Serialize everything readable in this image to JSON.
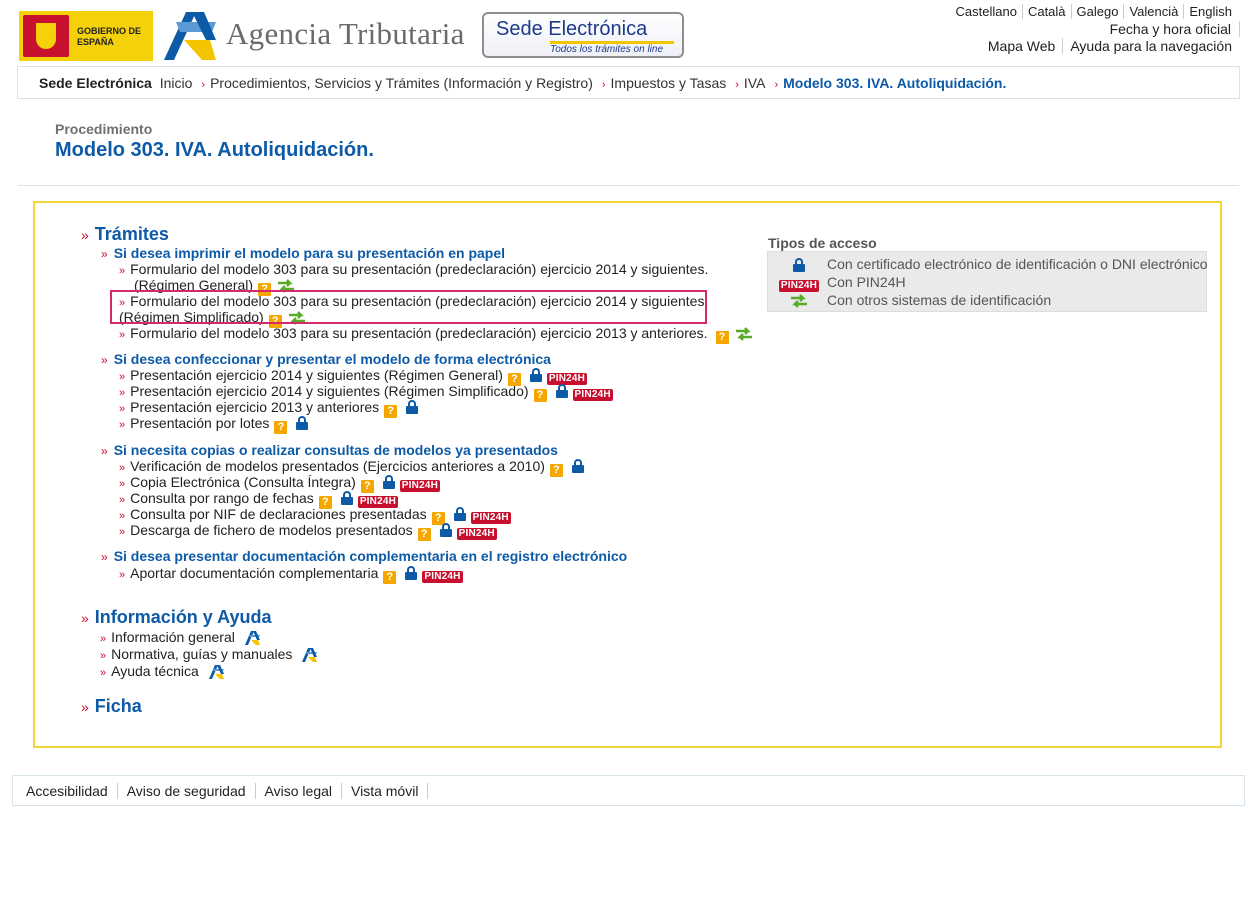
{
  "header": {
    "gobierno_text": "GOBIERNO DE ESPAÑA",
    "agencia": "Agencia Tributaria",
    "sede_title": "Sede Electrónica",
    "sede_sub": "Todos los trámites on line",
    "languages": [
      "Castellano",
      "Català",
      "Galego",
      "Valencià",
      "English"
    ],
    "fecha_hora": "Fecha y hora oficial",
    "mapa_web": "Mapa Web",
    "ayuda_nav": "Ayuda para la navegación"
  },
  "breadcrumb": {
    "label": "Sede Electrónica",
    "items": [
      "Inicio",
      "Procedimientos, Servicios y Trámites (Información y Registro)",
      "Impuestos y Tasas",
      "IVA"
    ],
    "current": "Modelo 303. IVA. Autoliquidación."
  },
  "page": {
    "kicker": "Procedimiento",
    "title": "Modelo 303. IVA. Autoliquidación."
  },
  "tramites": {
    "heading": "Trámites",
    "groups": [
      {
        "title": "Si desea imprimir el modelo para su presentación en papel",
        "items": [
          {
            "line1": "Formulario del modelo 303 para su presentación (predeclaración) ejercicio 2014 y siguientes.",
            "line2": "(Régimen General)"
          },
          {
            "line1": "Formulario del modelo 303 para su presentación (predeclaración) ejercicio 2014 y siguientes.",
            "line2": "(Régimen Simplificado)"
          },
          {
            "line1": "Formulario del modelo 303 para su presentación (predeclaración) ejercicio 2013 y anteriores."
          }
        ]
      },
      {
        "title": "Si desea confeccionar y presentar el modelo de forma electrónica",
        "items": [
          {
            "label": "Presentación ejercicio 2014 y siguientes (Régimen General)"
          },
          {
            "label": "Presentación ejercicio 2014 y siguientes (Régimen Simplificado)"
          },
          {
            "label": "Presentación ejercicio 2013 y anteriores"
          },
          {
            "label": "Presentación por lotes"
          }
        ]
      },
      {
        "title": "Si necesita copias o realizar consultas de modelos ya presentados",
        "items": [
          {
            "label": "Verificación de modelos presentados (Ejercicios anteriores a 2010)"
          },
          {
            "label": "Copia Electrónica (Consulta Íntegra)"
          },
          {
            "label": "Consulta por rango de fechas"
          },
          {
            "label": "Consulta por NIF de declaraciones presentadas"
          },
          {
            "label": "Descarga de fichero de modelos presentados"
          }
        ]
      },
      {
        "title": "Si desea presentar documentación complementaria en el registro electrónico",
        "items": [
          {
            "label": "Aportar documentación complementaria"
          }
        ]
      }
    ]
  },
  "info": {
    "heading": "Información y Ayuda",
    "items": [
      "Información general",
      "Normativa, guías y manuales",
      "Ayuda técnica"
    ]
  },
  "ficha": {
    "heading": "Ficha"
  },
  "tipos_acceso": {
    "title": "Tipos de acceso",
    "rows": [
      "Con certificado electrónico de identificación o DNI electrónico",
      "Con PIN24H",
      "Con otros sistemas de identificación"
    ]
  },
  "badges": {
    "help": "?",
    "pin": "PIN24H"
  },
  "footer": {
    "links": [
      "Accesibilidad",
      "Aviso de seguridad",
      "Aviso legal",
      "Vista móvil"
    ]
  },
  "colors": {
    "link_blue": "#0d5aa7",
    "bullet_red": "#c8102e",
    "box_yellow": "#f3d53a",
    "highlight": "#d4296d"
  }
}
